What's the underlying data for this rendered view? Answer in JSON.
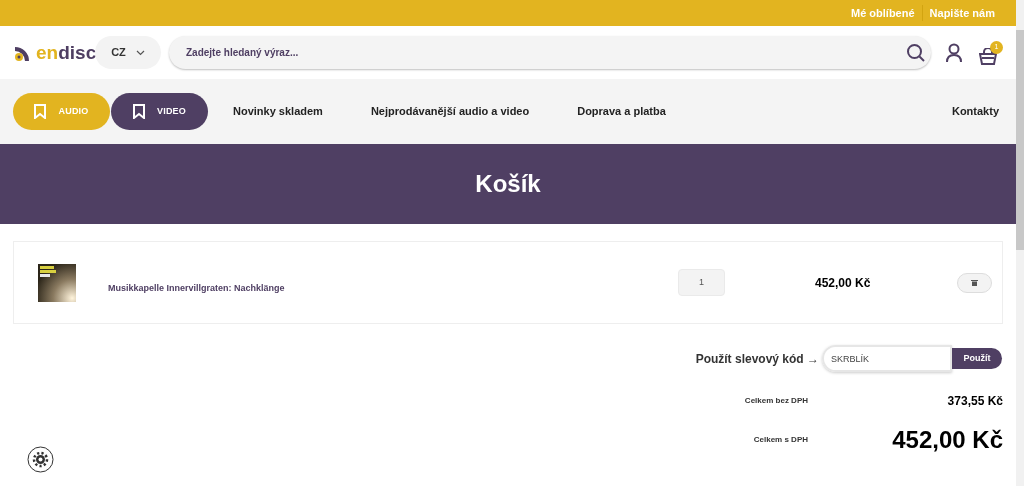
{
  "top_links": [
    "Mé oblíbené",
    "Napište nám"
  ],
  "header": {
    "logo_parts": [
      {
        "text": "en",
        "color": "#e2b420"
      },
      {
        "text": "disc",
        "color": "#4f3f63"
      }
    ],
    "language": "CZ",
    "search": {
      "placeholder": "Zadejte hledaný výraz..."
    },
    "cart_count": "1"
  },
  "nav": {
    "categories": [
      {
        "label": "AUDIO",
        "color": "#e2b420"
      },
      {
        "label": "VIDEO",
        "color": "#4f3f63"
      }
    ],
    "links": [
      "Novinky skladem",
      "Nejprodávanější audio a video",
      "Doprava a platba"
    ],
    "contact": "Kontakty"
  },
  "page_title": "Košík",
  "cart_items": [
    {
      "kind": "picture",
      "name": "Musikkapelle Innervillgraten: Nachklänge",
      "quantity": "1",
      "price": "452,00 Kč"
    }
  ],
  "discount": {
    "label": "Použít slevový kód →",
    "value": "SKRBLÍK",
    "button": "Použít"
  },
  "totals": [
    {
      "label": "Celkem bez DPH",
      "value": "373,55 Kč",
      "kind": "small"
    },
    {
      "label": "Celkem s DPH",
      "value": "452,00 Kč",
      "kind": "large"
    }
  ]
}
